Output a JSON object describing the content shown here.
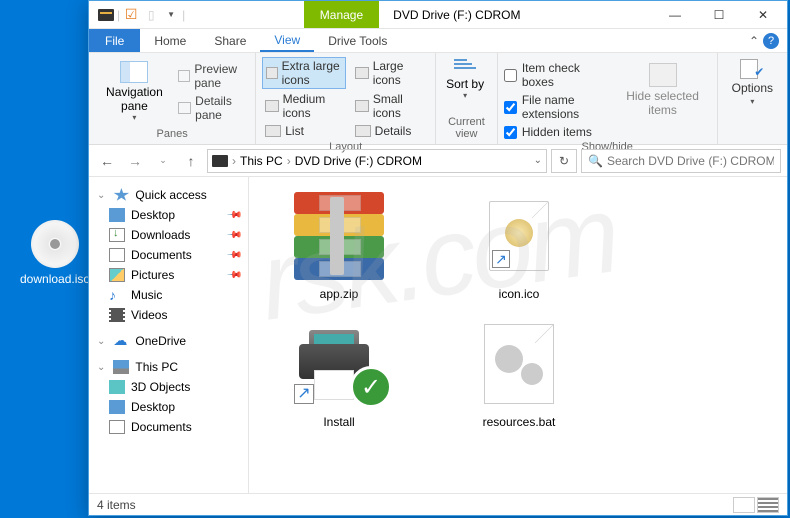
{
  "desktop": {
    "icon_label": "download.iso"
  },
  "window": {
    "context_tab": "Manage",
    "title": "DVD Drive (F:) CDROM",
    "menu": {
      "file": "File",
      "home": "Home",
      "share": "Share",
      "view": "View",
      "drive_tools": "Drive Tools"
    }
  },
  "ribbon": {
    "panes": {
      "label": "Panes",
      "navigation": "Navigation pane",
      "preview": "Preview pane",
      "details": "Details pane"
    },
    "layout": {
      "label": "Layout",
      "extra_large": "Extra large icons",
      "large": "Large icons",
      "medium": "Medium icons",
      "small": "Small icons",
      "list": "List",
      "details": "Details"
    },
    "current_view": {
      "label": "Current view",
      "sort_by": "Sort by"
    },
    "show_hide": {
      "label": "Show/hide",
      "item_check": "Item check boxes",
      "file_ext": "File name extensions",
      "hidden": "Hidden items",
      "hide_selected": "Hide selected items"
    },
    "options": "Options"
  },
  "address": {
    "segments": [
      "This PC",
      "DVD Drive (F:) CDROM"
    ],
    "search_placeholder": "Search DVD Drive (F:) CDROM"
  },
  "sidebar": {
    "quick_access": "Quick access",
    "items": [
      {
        "label": "Desktop",
        "pinned": true
      },
      {
        "label": "Downloads",
        "pinned": true
      },
      {
        "label": "Documents",
        "pinned": true
      },
      {
        "label": "Pictures",
        "pinned": true
      },
      {
        "label": "Music",
        "pinned": false
      },
      {
        "label": "Videos",
        "pinned": false
      }
    ],
    "onedrive": "OneDrive",
    "this_pc": "This PC",
    "pc_items": [
      {
        "label": "3D Objects"
      },
      {
        "label": "Desktop"
      },
      {
        "label": "Documents"
      }
    ]
  },
  "files": [
    {
      "name": "app.zip",
      "type": "archive"
    },
    {
      "name": "icon.ico",
      "type": "icon"
    },
    {
      "name": "Install",
      "type": "shortcut-printer"
    },
    {
      "name": "resources.bat",
      "type": "batch"
    }
  ],
  "status": {
    "count": "4 items"
  }
}
